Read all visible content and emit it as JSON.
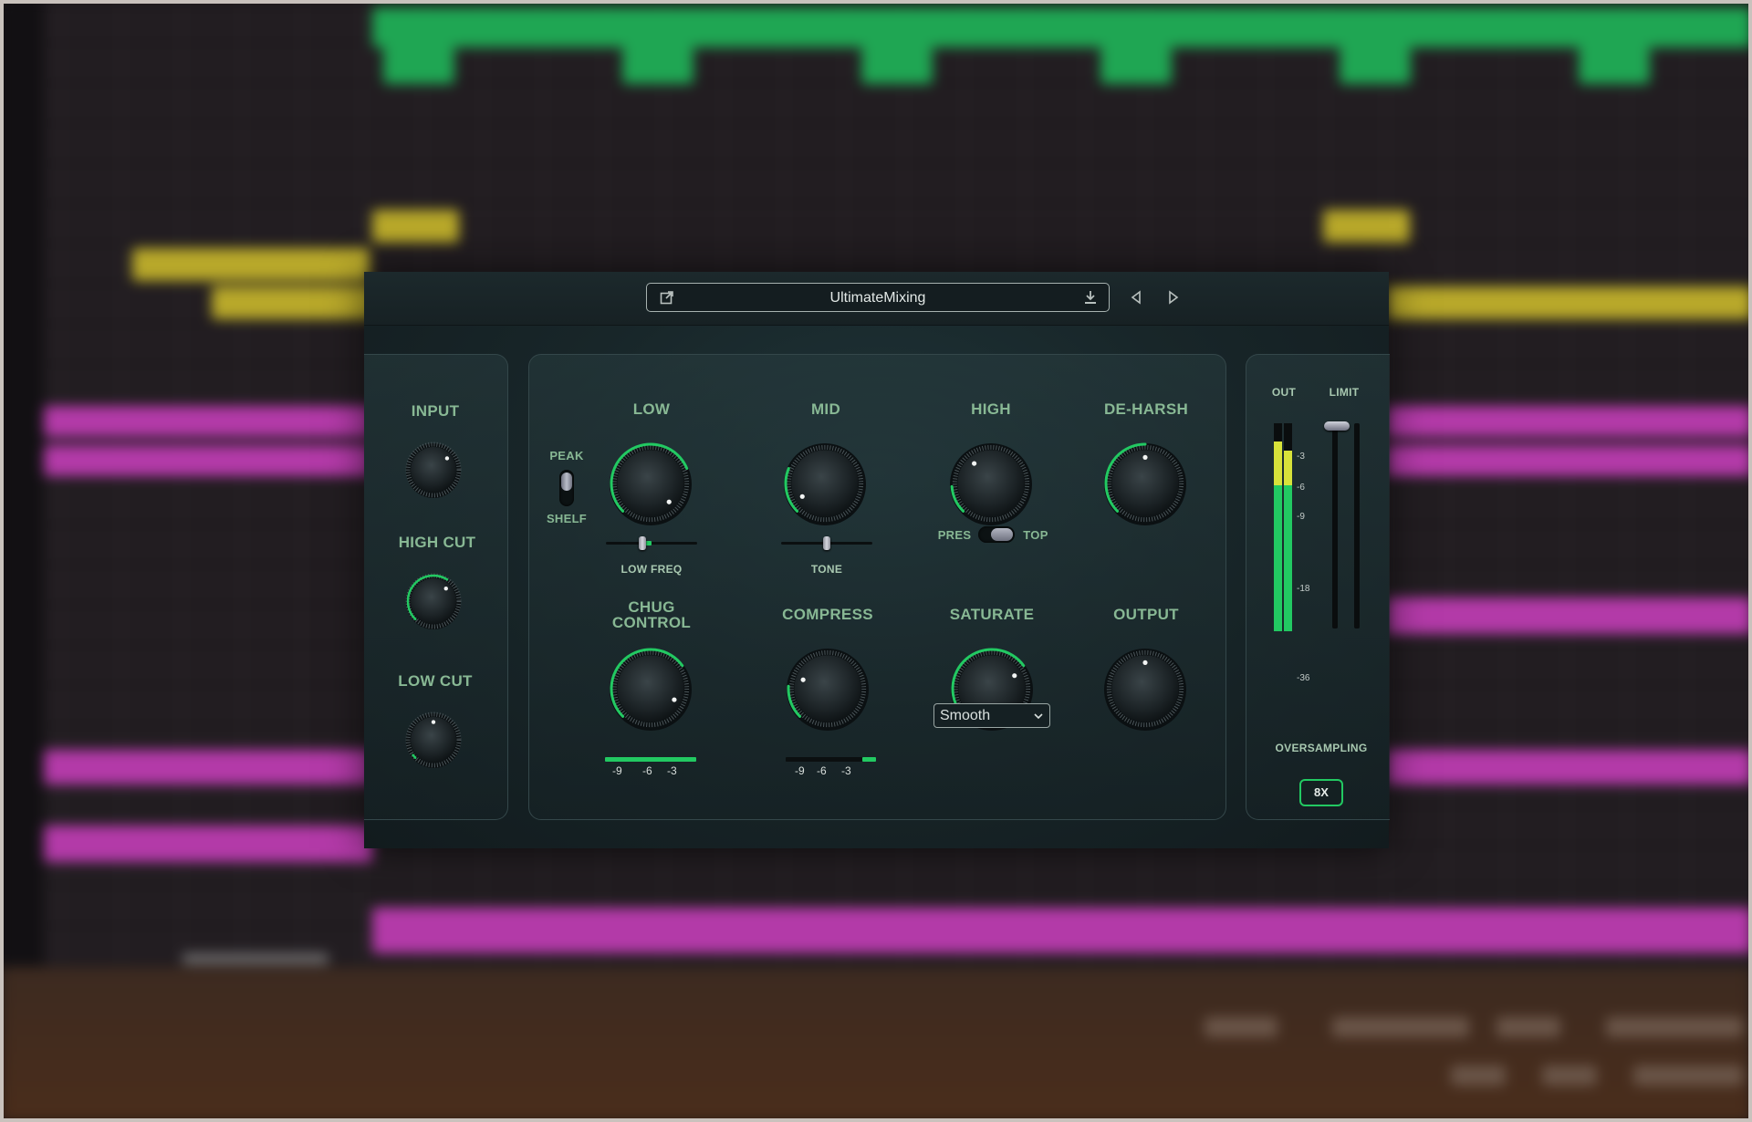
{
  "window": {
    "preset_name": "UltimateMixing"
  },
  "left": {
    "input_label": "INPUT",
    "high_cut_label": "HIGH CUT",
    "low_cut_label": "LOW CUT"
  },
  "eq": {
    "peak_label": "PEAK",
    "shelf_label": "SHELF",
    "low_label": "LOW",
    "mid_label": "MID",
    "high_label": "HIGH",
    "deharsh_label": "DE-HARSH",
    "low_freq_label": "LOW FREQ",
    "tone_label": "TONE",
    "pres_label": "PRES",
    "top_label": "TOP"
  },
  "dynamics": {
    "chug_label_line1": "CHUG",
    "chug_label_line2": "CONTROL",
    "compress_label": "COMPRESS",
    "saturate_label": "SATURATE",
    "output_label": "OUTPUT",
    "saturate_mode": "Smooth",
    "scale": [
      "-9",
      "-6",
      "-3"
    ]
  },
  "meters": {
    "out_label": "OUT",
    "limit_label": "LIMIT",
    "scale": [
      "-3",
      "-6",
      "-9",
      "-18",
      "-36"
    ],
    "oversampling_label": "OVERSAMPLING",
    "oversampling_value": "8X"
  },
  "colors": {
    "accent": "#22c962",
    "label": "#88b894"
  }
}
